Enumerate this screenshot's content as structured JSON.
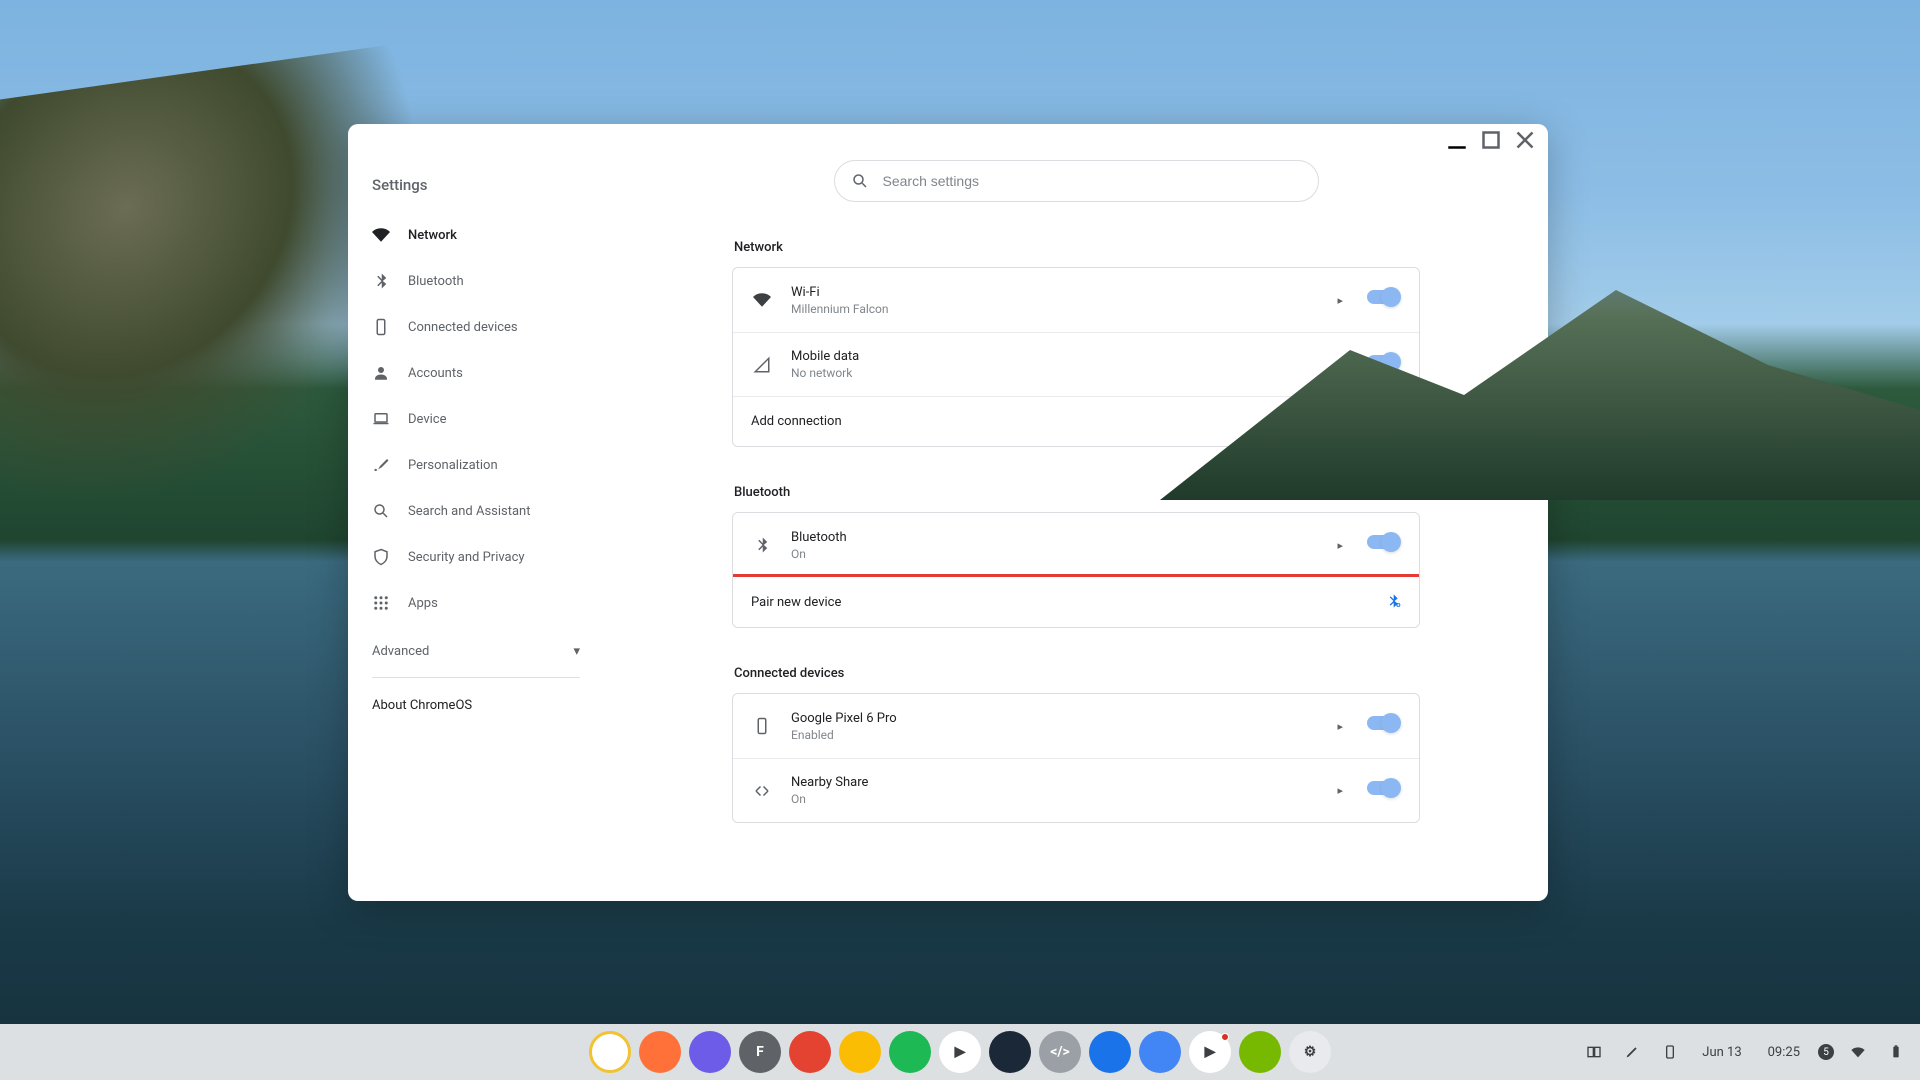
{
  "app_title": "Settings",
  "search": {
    "placeholder": "Search settings"
  },
  "sidebar": {
    "items": [
      {
        "label": "Network",
        "icon": "wifi",
        "active": true
      },
      {
        "label": "Bluetooth",
        "icon": "bt"
      },
      {
        "label": "Connected devices",
        "icon": "phone"
      },
      {
        "label": "Accounts",
        "icon": "person"
      },
      {
        "label": "Device",
        "icon": "laptop"
      },
      {
        "label": "Personalization",
        "icon": "brush"
      },
      {
        "label": "Search and Assistant",
        "icon": "search"
      },
      {
        "label": "Security and Privacy",
        "icon": "shield"
      },
      {
        "label": "Apps",
        "icon": "apps"
      }
    ],
    "advanced": "Advanced",
    "about": "About ChromeOS"
  },
  "sections": {
    "network": {
      "title": "Network",
      "wifi": {
        "title": "Wi-Fi",
        "sub": "Millennium Falcon",
        "on": true
      },
      "mobile": {
        "title": "Mobile data",
        "sub": "No network",
        "on": true
      },
      "add": {
        "title": "Add connection"
      }
    },
    "bluetooth": {
      "title": "Bluetooth",
      "bt": {
        "title": "Bluetooth",
        "sub": "On",
        "on": true
      },
      "pair": {
        "title": "Pair new device"
      }
    },
    "connected": {
      "title": "Connected devices",
      "phone": {
        "title": "Google Pixel 6 Pro",
        "sub": "Enabled",
        "on": true
      },
      "nearby": {
        "title": "Nearby Share",
        "sub": "On",
        "on": true
      }
    }
  },
  "highlight_row": "pair_new_device",
  "shelf": {
    "apps": [
      {
        "name": "chrome",
        "bg": "#fff",
        "ring": "#f1c232",
        "letter": ""
      },
      {
        "name": "firefox",
        "bg": "#ff7139",
        "letter": ""
      },
      {
        "name": "obsidian",
        "bg": "#6c5ce7",
        "letter": ""
      },
      {
        "name": "files-f",
        "bg": "#5f6368",
        "letter": "F"
      },
      {
        "name": "todoist",
        "bg": "#e44332",
        "letter": ""
      },
      {
        "name": "keep",
        "bg": "#fbbc04",
        "letter": ""
      },
      {
        "name": "spotify",
        "bg": "#1db954",
        "letter": ""
      },
      {
        "name": "play",
        "bg": "#ffffff",
        "letter": "▶"
      },
      {
        "name": "steam",
        "bg": "#1b2838",
        "letter": ""
      },
      {
        "name": "code",
        "bg": "#9aa0a6",
        "letter": "</>"
      },
      {
        "name": "messages",
        "bg": "#1a73e8",
        "letter": ""
      },
      {
        "name": "docs",
        "bg": "#4285f4",
        "letter": ""
      },
      {
        "name": "youtube",
        "bg": "#ffffff",
        "letter": "▶",
        "dot": true
      },
      {
        "name": "nvidia",
        "bg": "#76b900",
        "letter": ""
      },
      {
        "name": "settings",
        "bg": "#e8eaed",
        "letter": "⚙"
      }
    ],
    "tray": {
      "date": "Jun 13",
      "time": "09:25",
      "notif_count": "5"
    }
  }
}
